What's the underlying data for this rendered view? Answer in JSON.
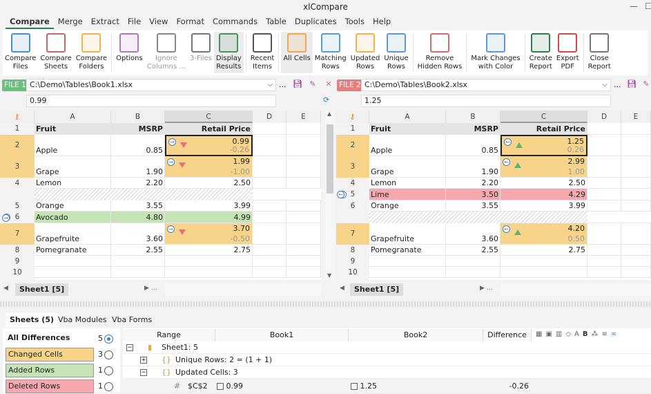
{
  "app": {
    "title": "xlCompare"
  },
  "menu": [
    "Compare",
    "Merge",
    "Extract",
    "File",
    "View",
    "Format",
    "Commands",
    "Table",
    "Duplicates",
    "Tools",
    "Help"
  ],
  "ribbon": [
    {
      "label": "Compare\nFiles",
      "icon": "compare-files-icon"
    },
    {
      "label": "Compare\nSheets",
      "icon": "compare-sheets-icon"
    },
    {
      "label": "Compare\nFolders",
      "icon": "folder-icon"
    },
    {
      "sep": true
    },
    {
      "label": "Options",
      "icon": "gear-icon"
    },
    {
      "label": "Ignore\nColumns ...",
      "icon": "ignore-columns-icon",
      "disabled": true
    },
    {
      "label": "3-Files",
      "icon": "three-files-icon",
      "disabled": true
    },
    {
      "label": "Display\nResults",
      "icon": "display-results-icon",
      "selected": true
    },
    {
      "sep": true
    },
    {
      "label": "Recent\nItems",
      "icon": "clock-icon"
    },
    {
      "sep": true
    },
    {
      "label": "All Cells",
      "icon": "all-cells-icon",
      "selected": true
    },
    {
      "label": "Matching\nRows",
      "icon": "matching-rows-icon"
    },
    {
      "label": "Updated\nRows",
      "icon": "updated-rows-icon"
    },
    {
      "label": "Unique\nRows",
      "icon": "unique-rows-icon"
    },
    {
      "sep": true
    },
    {
      "label": "Remove\nHidden Rows",
      "icon": "remove-hidden-rows-icon"
    },
    {
      "sep": true
    },
    {
      "label": "Mark Changes\nwith Color",
      "icon": "color-palette-icon"
    },
    {
      "sep": true
    },
    {
      "label": "Create\nReport",
      "icon": "excel-report-icon"
    },
    {
      "label": "Export\nPDF",
      "icon": "pdf-icon"
    },
    {
      "sep": true
    },
    {
      "label": "Close\nReport",
      "icon": "close-report-icon"
    }
  ],
  "file1": {
    "badge": "FILE 1",
    "path": "C:\\Demo\\Tables\\Book1.xlsx",
    "formula": "0.99",
    "color": "#6cbf7f"
  },
  "file2": {
    "badge": "FILE 2",
    "path": "C:\\Demo\\Tables\\Book2.xlsx",
    "formula": "1.25",
    "color": "#e57f7f"
  },
  "more_label": "...",
  "columns": [
    "A",
    "B",
    "C",
    "D",
    "E"
  ],
  "colors": {
    "changed": "#f7d48a",
    "added": "#c6e3b5",
    "deleted": "#f7a8ae"
  },
  "left_rows": [
    {
      "num": "1",
      "type": "header",
      "a": "Fruit",
      "b": "MSRP",
      "c": "Retail Price"
    },
    {
      "num": "2",
      "type": "changed",
      "a": "Apple",
      "b": "0.85",
      "c": "0.99",
      "d": "-0.26",
      "sel": true
    },
    {
      "num": "3",
      "type": "changed",
      "a": "Grape",
      "b": "1.90",
      "c": "1.99",
      "d": "-1.00"
    },
    {
      "num": "4",
      "type": "normal",
      "a": "Lemon",
      "b": "2.20",
      "c": "2.50"
    },
    {
      "num": "",
      "type": "hatch"
    },
    {
      "num": "5",
      "type": "normal",
      "a": "Orange",
      "b": "3.55",
      "c": "3.99"
    },
    {
      "num": "6",
      "type": "added",
      "a": "Avocado",
      "b": "4.80",
      "c": "4.99"
    },
    {
      "num": "7",
      "type": "changed",
      "a": "Grapefruite",
      "b": "3.60",
      "c": "3.70",
      "d": "-0.50"
    },
    {
      "num": "8",
      "type": "normal",
      "a": "Pomegranate",
      "b": "2.55",
      "c": "2.75"
    },
    {
      "num": "9",
      "type": "empty"
    },
    {
      "num": "10",
      "type": "empty"
    }
  ],
  "right_rows": [
    {
      "num": "1",
      "type": "header",
      "a": "Fruit",
      "b": "MSRP",
      "c": "Retail Price"
    },
    {
      "num": "2",
      "type": "changed",
      "a": "Apple",
      "b": "0.85",
      "c": "1.25",
      "d": "0.26",
      "sel": true
    },
    {
      "num": "3",
      "type": "changed",
      "a": "Grape",
      "b": "1.90",
      "c": "2.99",
      "d": "1.00"
    },
    {
      "num": "4",
      "type": "normal",
      "a": "Lemon",
      "b": "2.20",
      "c": "2.50"
    },
    {
      "num": "5",
      "type": "deleted",
      "a": "Lime",
      "b": "3.50",
      "c": "4.29"
    },
    {
      "num": "6",
      "type": "normal",
      "a": "Orange",
      "b": "3.55",
      "c": "3.99"
    },
    {
      "num": "",
      "type": "hatch"
    },
    {
      "num": "7",
      "type": "changed",
      "a": "Grapefruite",
      "b": "3.60",
      "c": "4.20",
      "d": "0.50"
    },
    {
      "num": "8",
      "type": "normal",
      "a": "Pomegranate",
      "b": "2.55",
      "c": "2.75"
    },
    {
      "num": "9",
      "type": "empty"
    },
    {
      "num": "10",
      "type": "empty"
    }
  ],
  "sheet_tab": "Sheet1 [5]",
  "bottom_tabs": [
    "Sheets (5)",
    "Vba Modules",
    "Vba Forms"
  ],
  "filters": [
    {
      "label": "All Differences",
      "count": "5",
      "selected": true
    },
    {
      "label": "Changed Cells",
      "count": "3",
      "color": "#f7d48a"
    },
    {
      "label": "Added Rows",
      "count": "1",
      "color": "#c6e3b5"
    },
    {
      "label": "Deleted Rows",
      "count": "1",
      "color": "#f7a8ae"
    }
  ],
  "table_headers": [
    "Range",
    "Book1",
    "Book2",
    "Difference"
  ],
  "tree": [
    {
      "toggle": "−",
      "text": "Sheet1: 5",
      "indent": 0,
      "icon": "sheet-icon"
    },
    {
      "toggle": "+",
      "text": "Unique Rows: 2 = (1 + 1)",
      "indent": 1,
      "icon": "unique-rows-icon"
    },
    {
      "toggle": "−",
      "text": "Updated Cells: 3",
      "indent": 1,
      "icon": "updated-cells-icon"
    }
  ],
  "detail_row": {
    "range": "$C$2",
    "book1": "0.99",
    "book2": "1.25",
    "difference": "-0.26"
  }
}
